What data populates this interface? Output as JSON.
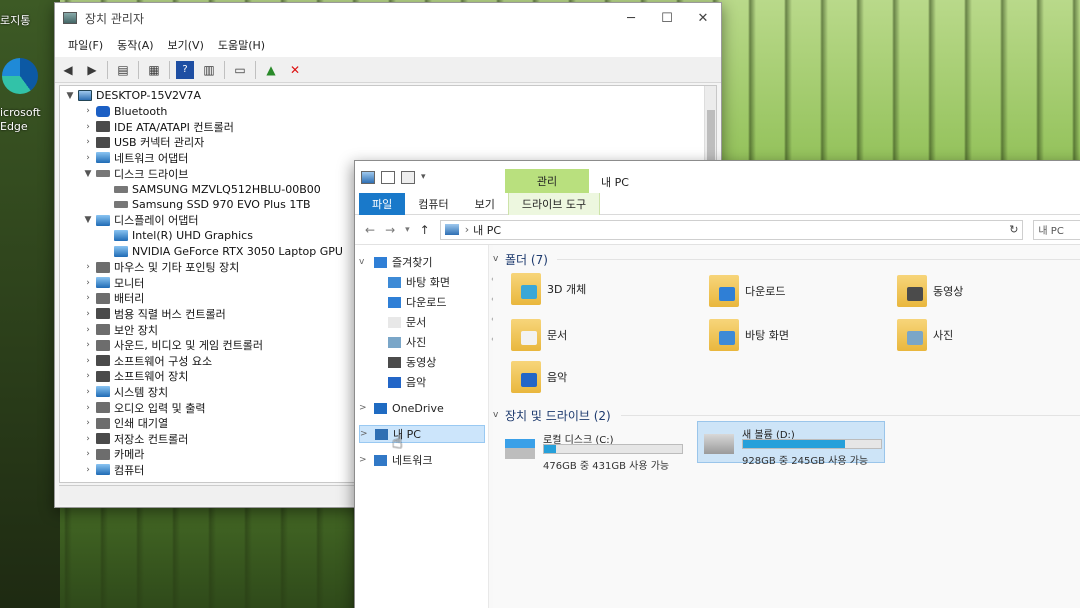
{
  "desktop": {
    "partial_label_top": "로지통",
    "edge_label_line1": "icrosoft",
    "edge_label_line2": "Edge"
  },
  "device_manager": {
    "title": "장치 관리자",
    "menu": [
      "파일(F)",
      "동작(A)",
      "보기(V)",
      "도움말(H)"
    ],
    "window_controls": [
      "─",
      "☐",
      "✕"
    ],
    "toolbar_icons": [
      "back-arrow-icon",
      "forward-arrow-icon",
      "properties-icon",
      "console-tree-icon",
      "help-icon",
      "view-icon",
      "monitor-icon",
      "update-driver-icon",
      "uninstall-icon"
    ],
    "tree": [
      {
        "label": "DESKTOP-15V2V7A",
        "level": 0,
        "expanded": true,
        "icon": "pc"
      },
      {
        "label": "Bluetooth",
        "level": 1,
        "expanded": false,
        "icon": "bt"
      },
      {
        "label": "IDE ATA/ATAPI 컨트롤러",
        "level": 1,
        "expanded": false,
        "icon": "chip"
      },
      {
        "label": "USB 커넥터 관리자",
        "level": 1,
        "expanded": false,
        "icon": "chip"
      },
      {
        "label": "네트워크 어댑터",
        "level": 1,
        "expanded": false,
        "icon": "monitor"
      },
      {
        "label": "디스크 드라이브",
        "level": 1,
        "expanded": true,
        "icon": "disk"
      },
      {
        "label": "SAMSUNG MZVLQ512HBLU-00B00",
        "level": 2,
        "expanded": null,
        "icon": "disk"
      },
      {
        "label": "Samsung SSD 970 EVO Plus 1TB",
        "level": 2,
        "expanded": null,
        "icon": "disk"
      },
      {
        "label": "디스플레이 어댑터",
        "level": 1,
        "expanded": true,
        "icon": "monitor"
      },
      {
        "label": "Intel(R) UHD Graphics",
        "level": 2,
        "expanded": null,
        "icon": "monitor"
      },
      {
        "label": "NVIDIA GeForce RTX 3050 Laptop GPU",
        "level": 2,
        "expanded": null,
        "icon": "monitor"
      },
      {
        "label": "마우스 및 기타 포인팅 장치",
        "level": 1,
        "expanded": false,
        "icon": "gray"
      },
      {
        "label": "모니터",
        "level": 1,
        "expanded": false,
        "icon": "monitor"
      },
      {
        "label": "배터리",
        "level": 1,
        "expanded": false,
        "icon": "gray"
      },
      {
        "label": "범용 직렬 버스 컨트롤러",
        "level": 1,
        "expanded": false,
        "icon": "chip"
      },
      {
        "label": "보안 장치",
        "level": 1,
        "expanded": false,
        "icon": "gray"
      },
      {
        "label": "사운드, 비디오 및 게임 컨트롤러",
        "level": 1,
        "expanded": false,
        "icon": "gray"
      },
      {
        "label": "소프트웨어 구성 요소",
        "level": 1,
        "expanded": false,
        "icon": "chip"
      },
      {
        "label": "소프트웨어 장치",
        "level": 1,
        "expanded": false,
        "icon": "chip"
      },
      {
        "label": "시스템 장치",
        "level": 1,
        "expanded": false,
        "icon": "monitor"
      },
      {
        "label": "오디오 입력 및 출력",
        "level": 1,
        "expanded": false,
        "icon": "gray"
      },
      {
        "label": "인쇄 대기열",
        "level": 1,
        "expanded": false,
        "icon": "gray"
      },
      {
        "label": "저장소 컨트롤러",
        "level": 1,
        "expanded": false,
        "icon": "chip"
      },
      {
        "label": "카메라",
        "level": 1,
        "expanded": false,
        "icon": "gray"
      },
      {
        "label": "컴퓨터",
        "level": 1,
        "expanded": false,
        "icon": "monitor"
      }
    ]
  },
  "explorer": {
    "context_tab": "관리",
    "window_title": "내 PC",
    "ribbon_tabs": [
      "파일",
      "컴퓨터",
      "보기",
      "드라이브 도구"
    ],
    "address_path": "내 PC",
    "search_placeholder": "내 PC",
    "nav": [
      {
        "label": "즐겨찾기",
        "chevron": "v",
        "icon": "star-icon",
        "pinned": false
      },
      {
        "label": "바탕 화면",
        "chevron": "",
        "icon": "desktop-icon",
        "pinned": true
      },
      {
        "label": "다운로드",
        "chevron": "",
        "icon": "download-icon",
        "pinned": true
      },
      {
        "label": "문서",
        "chevron": "",
        "icon": "document-icon",
        "pinned": true
      },
      {
        "label": "사진",
        "chevron": "",
        "icon": "picture-icon",
        "pinned": true
      },
      {
        "label": "동영상",
        "chevron": "",
        "icon": "video-icon",
        "pinned": false
      },
      {
        "label": "음악",
        "chevron": "",
        "icon": "music-icon",
        "pinned": false
      },
      {
        "label": "OneDrive",
        "chevron": ">",
        "icon": "cloud-icon",
        "pinned": false
      },
      {
        "label": "내 PC",
        "chevron": ">",
        "icon": "pc-icon",
        "pinned": false
      },
      {
        "label": "네트워크",
        "chevron": ">",
        "icon": "network-icon",
        "pinned": false
      }
    ],
    "folders_header": "폴더 (7)",
    "folders": [
      {
        "label": "3D 개체",
        "badge_color": "#3aa7d8"
      },
      {
        "label": "다운로드",
        "badge_color": "#2f7fd6"
      },
      {
        "label": "동영상",
        "badge_color": "#4b4b4b"
      },
      {
        "label": "문서",
        "badge_color": "#f2f2f2"
      },
      {
        "label": "바탕 화면",
        "badge_color": "#3d8ad6"
      },
      {
        "label": "사진",
        "badge_color": "#7aa6c8"
      },
      {
        "label": "음악",
        "badge_color": "#2366c7"
      }
    ],
    "drives_header": "장치 및 드라이브 (2)",
    "drives": [
      {
        "name": "로컬 디스크 (C:)",
        "size_text": "476GB 중 431GB 사용 가능",
        "used_fraction": 0.09,
        "selected": false
      },
      {
        "name": "새 볼륨 (D:)",
        "size_text": "928GB 중 245GB 사용 가능",
        "used_fraction": 0.74,
        "selected": true
      }
    ]
  }
}
